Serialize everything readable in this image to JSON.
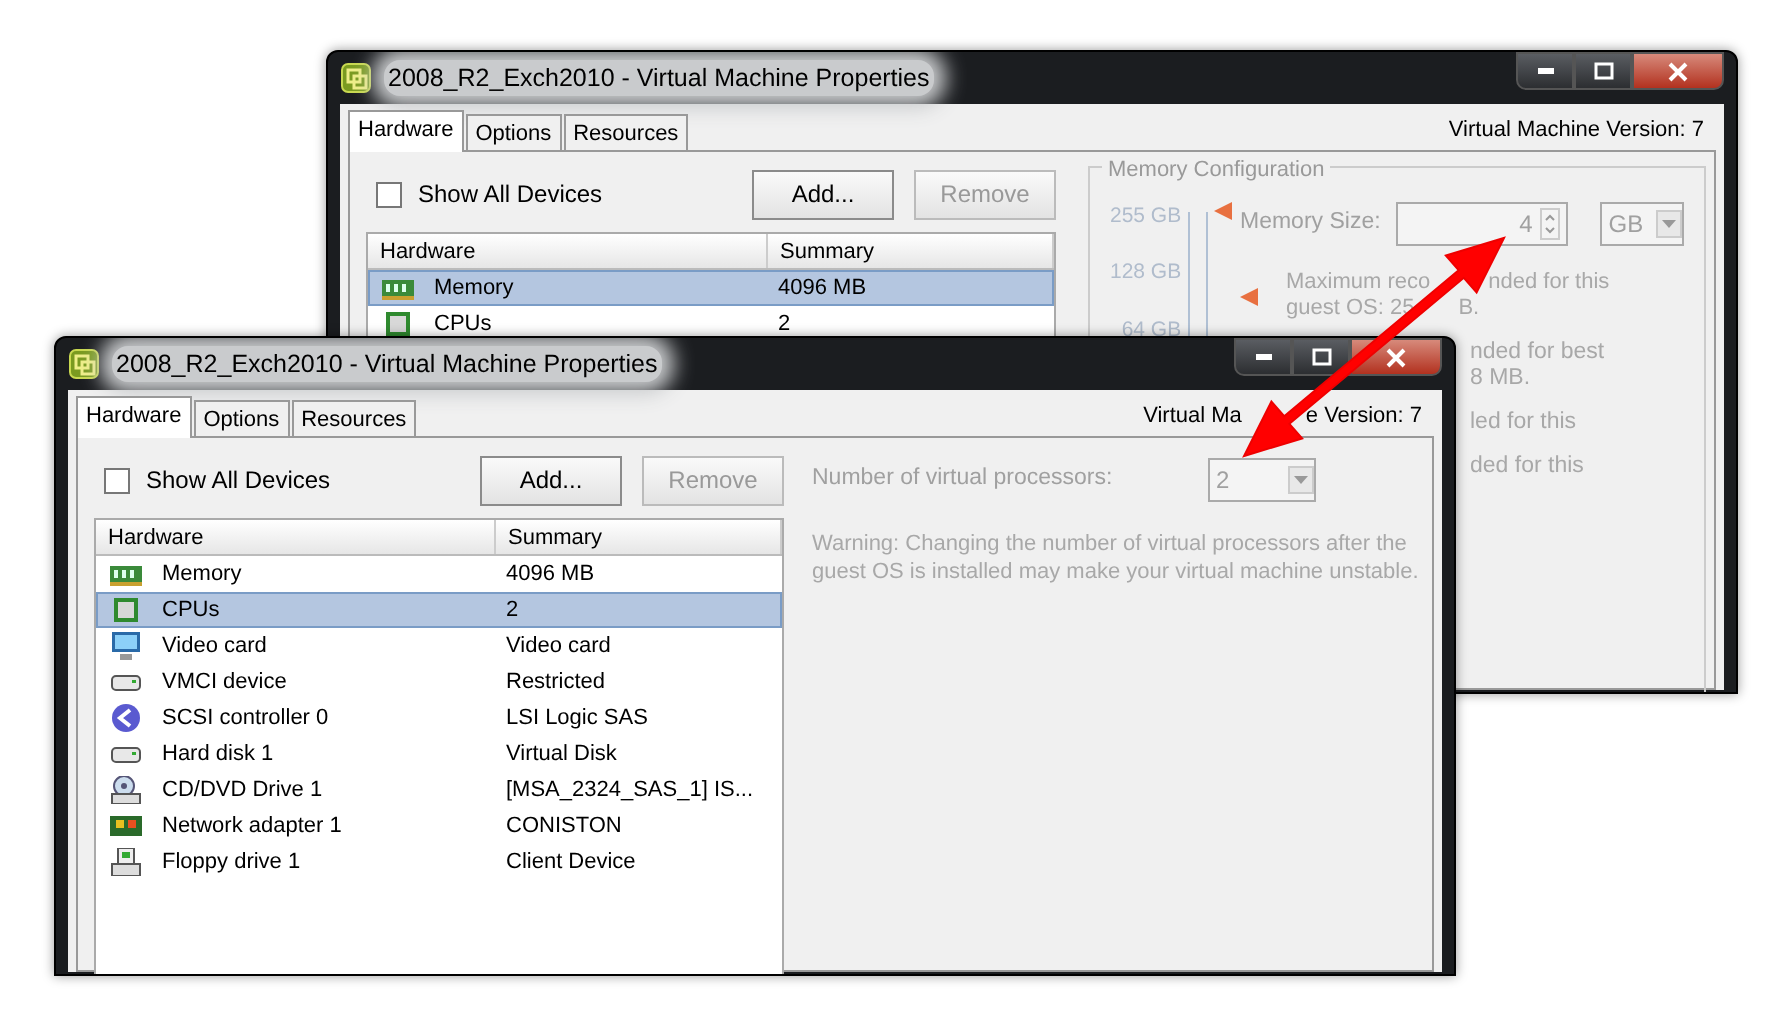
{
  "windows": [
    {
      "title": "2008_R2_Exch2010 - Virtual Machine Properties",
      "tabs": [
        {
          "label": "Hardware",
          "selected": true
        },
        {
          "label": "Options",
          "selected": false
        },
        {
          "label": "Resources",
          "selected": false
        }
      ],
      "version": [
        "Virtual Machine Version: 7"
      ],
      "show_all_devices": {
        "label": "Show All Devices",
        "checked": false
      },
      "buttons": [
        {
          "label": "Add...",
          "disabled": false
        },
        {
          "label": "Remove",
          "disabled": true
        }
      ],
      "table": {
        "columns": [
          "Hardware",
          "Summary"
        ],
        "rows": [
          {
            "kind": "memory",
            "name": "Memory",
            "summary": "4096 MB",
            "selected": true
          },
          {
            "kind": "cpu",
            "name": "CPUs",
            "summary": "2",
            "selected": false
          }
        ]
      },
      "panel": {
        "kind": "memory",
        "title": "Memory Configuration",
        "scale": [
          "255 GB",
          "128 GB",
          "64 GB"
        ],
        "size_label": "Memory Size:",
        "size_value": "4",
        "unit": "GB",
        "notes": [
          {
            "kind": "full",
            "lines": [
              [
                "Maximum reco",
                "nded for this"
              ],
              [
                "guest OS: 25",
                "B."
              ]
            ]
          },
          {
            "kind": "clipped",
            "text": "nded for best"
          },
          {
            "kind": "clipped",
            "text": "8 MB."
          },
          {
            "kind": "clipped",
            "text": "led for this"
          },
          {
            "kind": "clipped",
            "text": "ded for this"
          }
        ]
      }
    },
    {
      "title": "2008_R2_Exch2010 - Virtual Machine Properties",
      "tabs": [
        {
          "label": "Hardware",
          "selected": true
        },
        {
          "label": "Options",
          "selected": false
        },
        {
          "label": "Resources",
          "selected": false
        }
      ],
      "version": [
        "Virtual Ma",
        "e Version: 7"
      ],
      "show_all_devices": {
        "label": "Show All Devices",
        "checked": false
      },
      "buttons": [
        {
          "label": "Add...",
          "disabled": false
        },
        {
          "label": "Remove",
          "disabled": true
        }
      ],
      "table": {
        "columns": [
          "Hardware",
          "Summary"
        ],
        "rows": [
          {
            "kind": "memory",
            "name": "Memory",
            "summary": "4096 MB",
            "selected": false
          },
          {
            "kind": "cpu",
            "name": "CPUs",
            "summary": "2",
            "selected": true
          },
          {
            "kind": "video",
            "name": "Video card",
            "summary": "Video card",
            "selected": false
          },
          {
            "kind": "device",
            "name": "VMCI device",
            "summary": "Restricted",
            "selected": false
          },
          {
            "kind": "scsi",
            "name": "SCSI controller 0",
            "summary": "LSI Logic SAS",
            "selected": false
          },
          {
            "kind": "device",
            "name": "Hard disk 1",
            "summary": "Virtual Disk",
            "selected": false
          },
          {
            "kind": "cdrom",
            "name": "CD/DVD Drive 1",
            "summary": "[MSA_2324_SAS_1] IS...",
            "selected": false
          },
          {
            "kind": "nic",
            "name": "Network adapter 1",
            "summary": "CONISTON",
            "selected": false
          },
          {
            "kind": "floppy",
            "name": "Floppy drive 1",
            "summary": "Client Device",
            "selected": false
          }
        ]
      },
      "panel": {
        "kind": "cpu",
        "label": "Number of virtual processors:",
        "value": "2",
        "disabled": true,
        "warning": "Warning: Changing the number of virtual processors after the guest OS is installed may make your virtual machine unstable."
      }
    }
  ]
}
